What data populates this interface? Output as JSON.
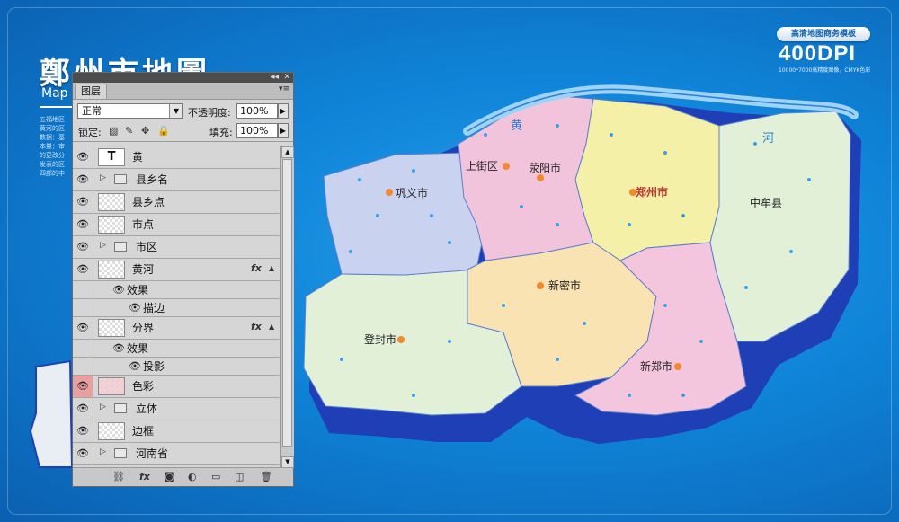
{
  "map": {
    "title": "鄭州市地圖",
    "subtitle": "Map o",
    "watermark_badge": "高清地图商务模板",
    "watermark_dpi": "400DPI",
    "watermark_sub": "10000*7000高精度图像，CMYK色彩",
    "blurb": [
      "五福地区",
      "黄河的区",
      "数据：基",
      "本量：审",
      "的更改分",
      "发表的区",
      "四部的中"
    ],
    "cities": {
      "gongyi": "巩义市",
      "shangjie": "上街区",
      "xingyang": "荥阳市",
      "zhengzhou": "郑州市",
      "zhongmou": "中牟县",
      "xinmi": "新密市",
      "dengfeng": "登封市",
      "xinzheng": "新郑市"
    },
    "river": {
      "huang": "黄",
      "he": "河"
    },
    "colors": {
      "background": "#1a8fe0",
      "gongyi": "#c9d3f0",
      "xingyang": "#f2c4dc",
      "zhengzhou": "#f5f0a8",
      "zhongmou": "#e3f0d8",
      "xinmi": "#f9e3b2",
      "dengfeng": "#e3f0d8",
      "xinzheng": "#f3c6dd",
      "extrusion": "#1e3fb5"
    }
  },
  "panel": {
    "tab_label": "图层",
    "blend_mode": "正常",
    "opacity_label": "不透明度:",
    "opacity_value": "100%",
    "lock_label": "锁定:",
    "fill_label": "填充:",
    "fill_value": "100%",
    "layers": [
      {
        "name": "黄",
        "kind": "text"
      },
      {
        "name": "县乡名",
        "kind": "group"
      },
      {
        "name": "县乡点",
        "kind": "layer"
      },
      {
        "name": "市点",
        "kind": "layer"
      },
      {
        "name": "市区",
        "kind": "group"
      },
      {
        "name": "黄河",
        "kind": "layer",
        "fx": true,
        "effects_label": "效果",
        "effects": [
          "描边"
        ]
      },
      {
        "name": "分界",
        "kind": "layer",
        "fx": true,
        "effects_label": "效果",
        "effects": [
          "投影"
        ]
      },
      {
        "name": "色彩",
        "kind": "color",
        "active": true
      },
      {
        "name": "立体",
        "kind": "group"
      },
      {
        "name": "边框",
        "kind": "layer"
      },
      {
        "name": "河南省",
        "kind": "group"
      }
    ],
    "fx_label": "fx",
    "footer_buttons": [
      "link-icon",
      "fx-icon",
      "mask-icon",
      "adjustment-icon",
      "new-group-icon",
      "new-layer-icon",
      "trash-icon"
    ]
  }
}
